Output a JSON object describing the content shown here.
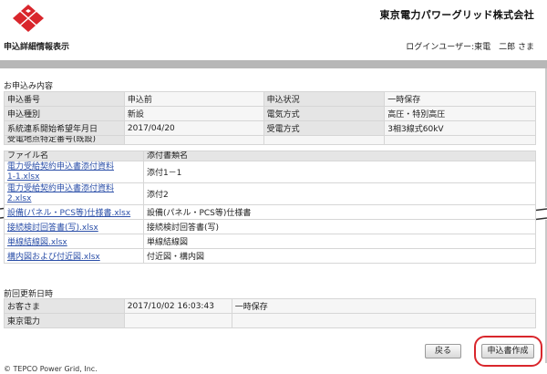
{
  "header": {
    "company": "東京電力パワーグリッド株式会社",
    "page_title": "申込詳細情報表示",
    "user_info": "ログインユーザー:東電　二郎 さま",
    "logo_color": "#d9262c"
  },
  "application": {
    "section_title": "お申込み内容",
    "rows": [
      {
        "l1": "申込番号",
        "v1": "申込前",
        "l2": "申込状況",
        "v2": "一時保存"
      },
      {
        "l1": "申込種別",
        "v1": "新設",
        "l2": "電気方式",
        "v2": "高圧・特別高圧"
      },
      {
        "l1": "系統連系開始希望年月日",
        "v1": "2017/04/20",
        "l2": "受電方式",
        "v2": "3相3線式60kV"
      }
    ],
    "cut_label": "受電地点特定番号(既設)"
  },
  "files": {
    "header_label": "ファイル名",
    "header_cut": "添付書類名",
    "rows": [
      {
        "file": "電力受給契約申込書添付資料1-1.xlsx",
        "file_l1": "電力受給契約申込書添付資料",
        "file_l2": "1-1.xlsx",
        "desc": "添付1－1"
      },
      {
        "file": "電力受給契約申込書添付資料2.xlsx",
        "file_l1": "電力受給契約申込書添付資料",
        "file_l2": "2.xlsx",
        "desc": "添付2"
      },
      {
        "file": "設備(パネル・PCS等)仕様書.xlsx",
        "desc": "設備(パネル・PCS等)仕様書"
      },
      {
        "file": "接続検討回答書(写).xlsx",
        "desc": "接続検討回答書(写)"
      },
      {
        "file": "単線結線図.xlsx",
        "desc": "単線結線図"
      },
      {
        "file": "構内図および付近図.xlsx",
        "desc": "付近図・構内図"
      }
    ]
  },
  "last_update": {
    "section_title": "前回更新日時",
    "rows": [
      {
        "label": "お客さま",
        "datetime": "2017/10/02 16:03:43",
        "status": "一時保存"
      },
      {
        "label": "東京電力",
        "datetime": "",
        "status": ""
      }
    ]
  },
  "buttons": {
    "back": "戻る",
    "create": "申込書作成",
    "highlight_color": "#d9262c"
  },
  "footer": {
    "copyright": "© TEPCO Power Grid, Inc."
  }
}
